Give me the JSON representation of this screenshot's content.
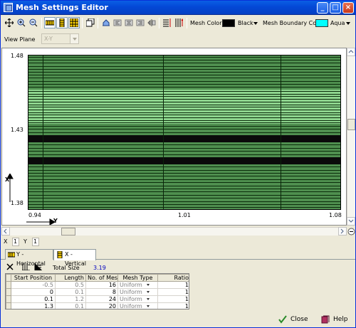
{
  "window": {
    "title": "Mesh Settings Editor",
    "controls": {
      "minimize": "_",
      "maximize": "□",
      "close": "×"
    }
  },
  "toolbar": {
    "mesh_color_label": "Mesh Color",
    "mesh_color_value": "Black",
    "mesh_color_swatch": "#000000",
    "boundary_color_label": "Mesh Boundary Color",
    "boundary_color_value": "Aqua",
    "boundary_color_swatch": "#00ffff"
  },
  "view_plane": {
    "label": "View Plane",
    "value": "X-Y"
  },
  "plot": {
    "y_ticks": [
      "1.48",
      "1.43",
      "1.38"
    ],
    "x_ticks": [
      "0.94",
      "1.01",
      "1.08"
    ],
    "x_axis_label": "Y",
    "y_axis_label": "X",
    "colors": {
      "mesh_fill": "#4f8f4f",
      "light_band": "#8fd68f",
      "dark_band": "#0a0a0a"
    }
  },
  "status": {
    "x_label": "X",
    "x_value": "1",
    "y_label": "Y",
    "y_value": "1"
  },
  "tabs": [
    {
      "label": "Y - Horizontal"
    },
    {
      "label": "X - Vertical"
    }
  ],
  "subtoolbar": {
    "total_size_label": "Total Size",
    "total_size_value": "3.19"
  },
  "table": {
    "headers": [
      "Start Position",
      "Length",
      "No. of Meshes",
      "Mesh Type",
      "Ratio"
    ],
    "rows": [
      {
        "start": "-0.5",
        "length": "0.5",
        "meshes": "16",
        "type": "Uniform",
        "ratio": "1"
      },
      {
        "start": "0",
        "length": "0.1",
        "meshes": "8",
        "type": "Uniform",
        "ratio": "1"
      },
      {
        "start": "0.1",
        "length": "1.2",
        "meshes": "24",
        "type": "Uniform",
        "ratio": "1"
      },
      {
        "start": "1.3",
        "length": "0.1",
        "meshes": "20",
        "type": "Uniform",
        "ratio": "1"
      }
    ]
  },
  "buttons": {
    "close": "Close",
    "help": "Help"
  }
}
